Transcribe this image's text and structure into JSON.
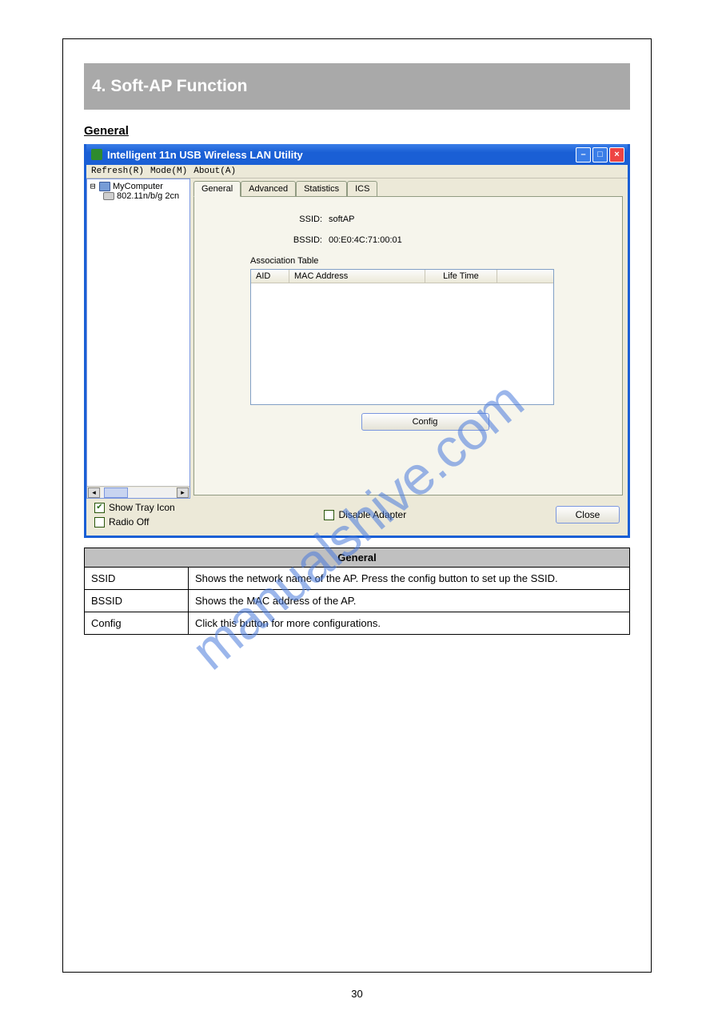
{
  "gray_bar": "4. Soft-AP Function",
  "section_title": "General",
  "window": {
    "title": "Intelligent 11n USB Wireless LAN Utility",
    "menu": {
      "refresh": "Refresh(R)",
      "mode": "Mode(M)",
      "about": "About(A)"
    },
    "tree": {
      "root": "MyComputer",
      "device": "802.11n/b/g 2cn"
    },
    "tabs": {
      "general": "General",
      "advanced": "Advanced",
      "statistics": "Statistics",
      "ics": "ICS"
    },
    "fields": {
      "ssid_label": "SSID:",
      "ssid_value": "softAP",
      "bssid_label": "BSSID:",
      "bssid_value": "00:E0:4C:71:00:01",
      "assoc_title": "Association Table",
      "col_aid": "AID",
      "col_mac": "MAC Address",
      "col_life": "Life Time"
    },
    "config_btn": "Config",
    "show_tray": "Show Tray Icon",
    "radio_off": "Radio Off",
    "disable_adapter": "Disable Adapter",
    "close_btn": "Close"
  },
  "table": {
    "header": "General",
    "rows": [
      {
        "k": "SSID",
        "v": "Shows the network name of the AP. Press the config button to set up the SSID."
      },
      {
        "k": "BSSID",
        "v": "Shows the MAC address of the AP."
      },
      {
        "k": "Config",
        "v": "Click this button for more configurations."
      }
    ]
  },
  "watermark": "manualshive.com",
  "page_number": "30"
}
